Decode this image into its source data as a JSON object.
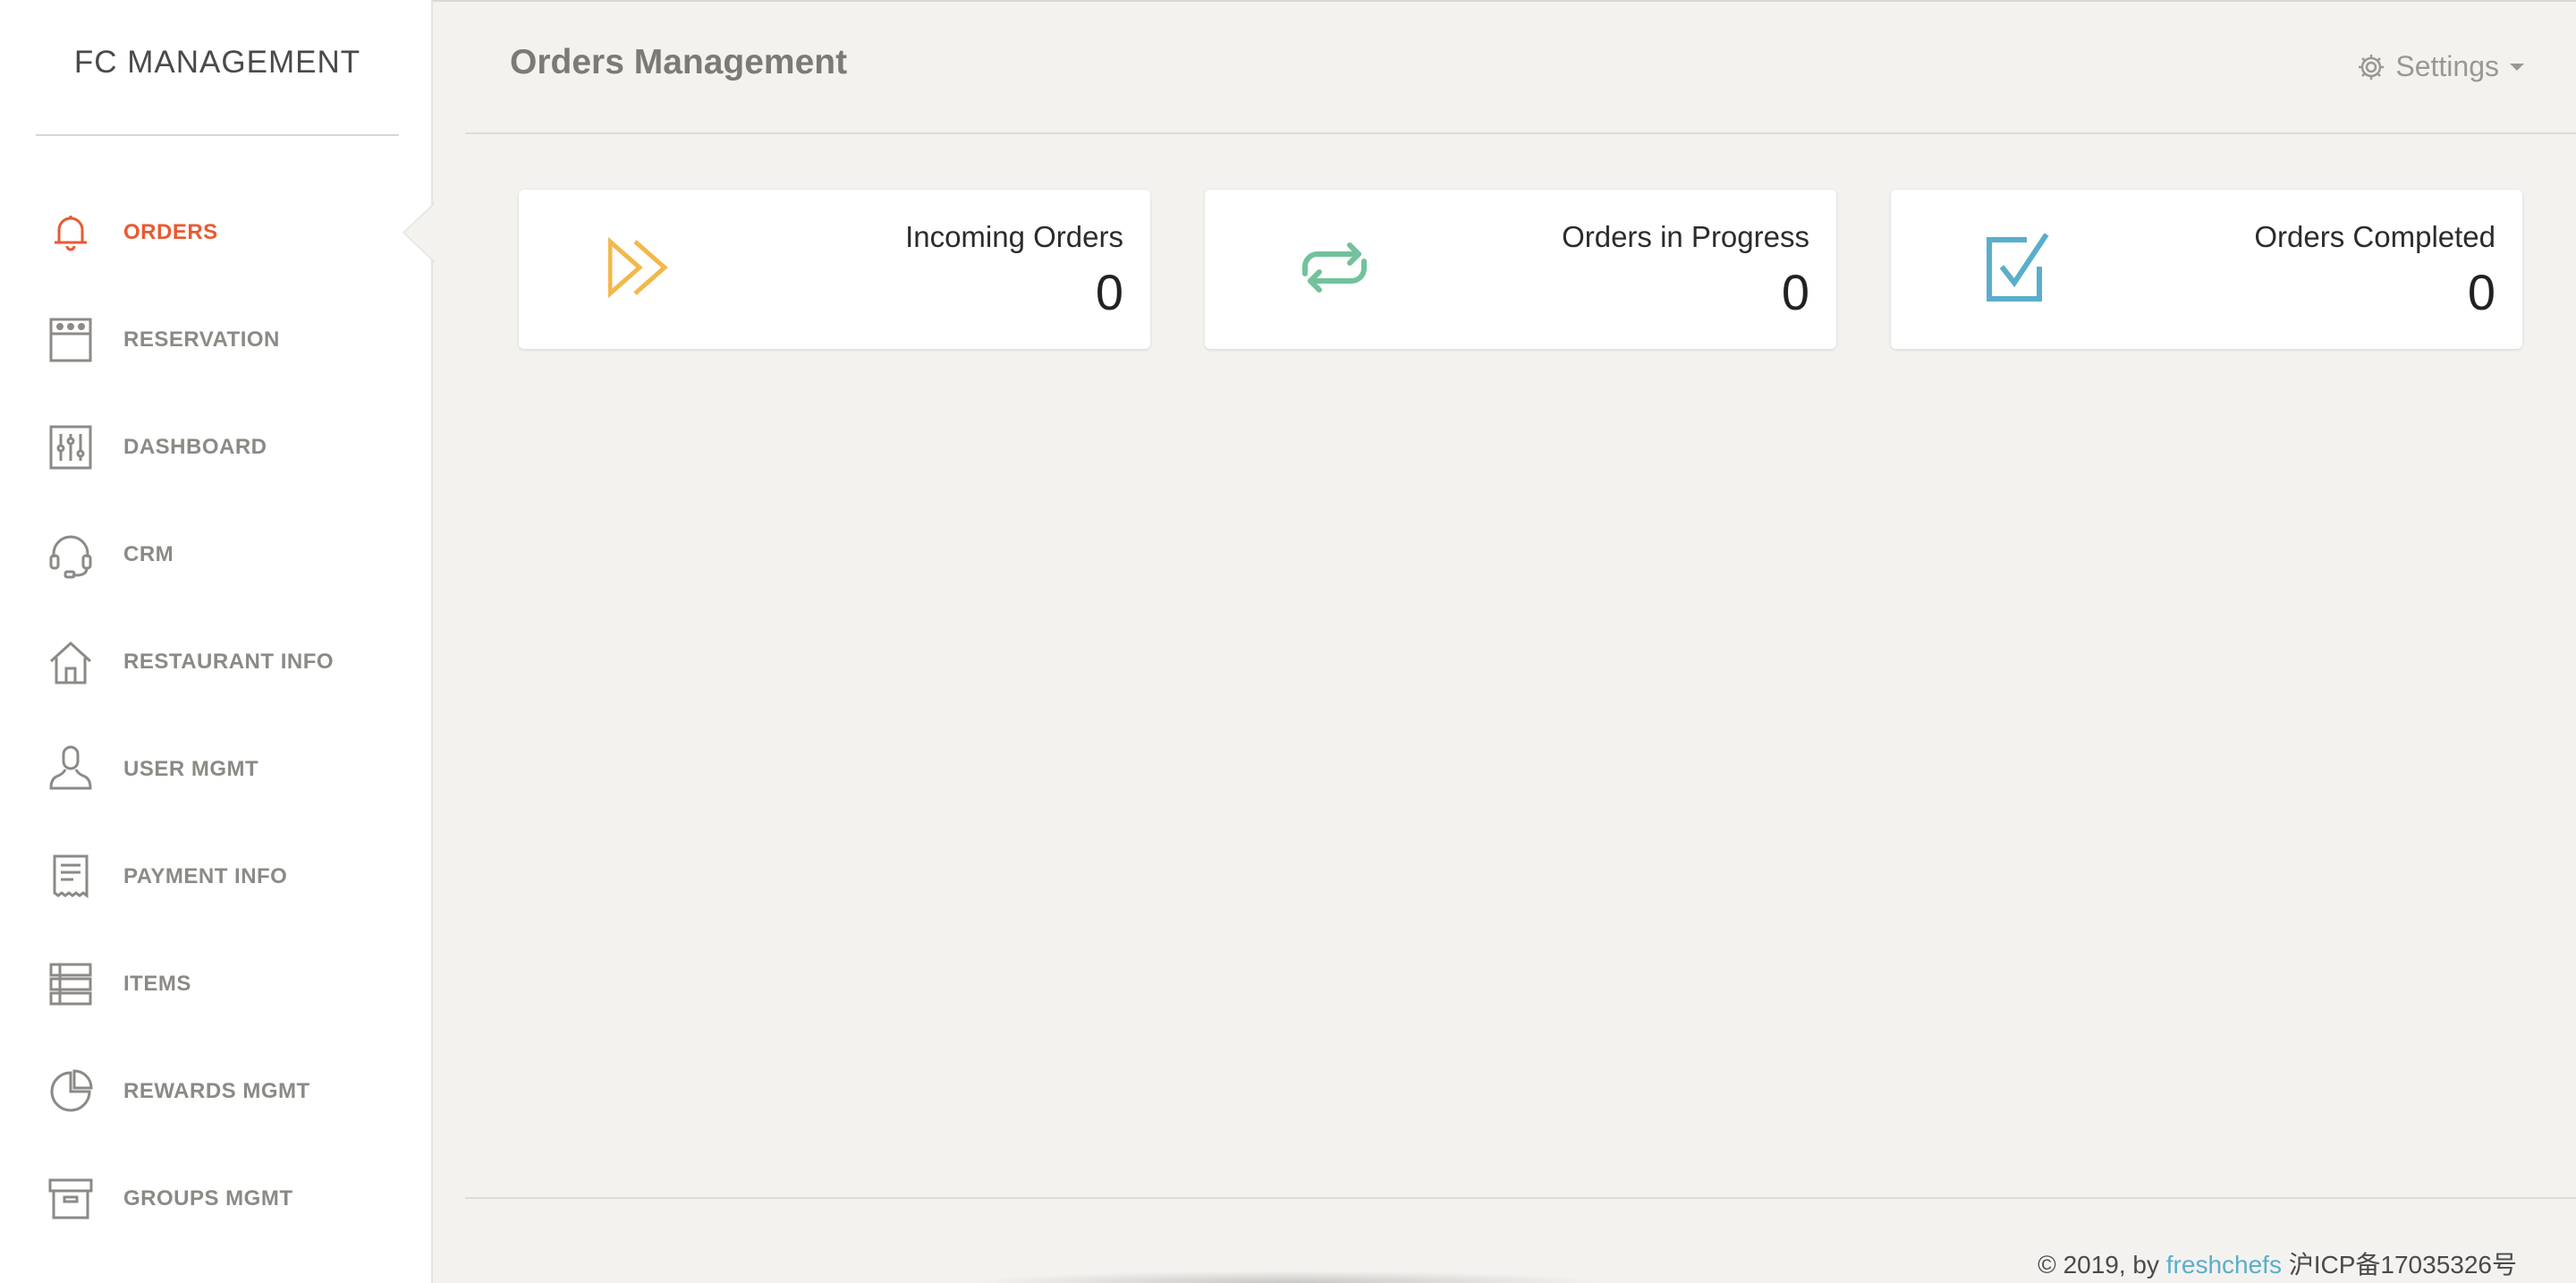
{
  "brand": "FC MANAGEMENT",
  "nav": {
    "items": [
      {
        "label": "ORDERS",
        "icon": "bell-icon",
        "active": true
      },
      {
        "label": "RESERVATION",
        "icon": "calendar-icon",
        "active": false
      },
      {
        "label": "DASHBOARD",
        "icon": "sliders-icon",
        "active": false
      },
      {
        "label": "CRM",
        "icon": "headset-icon",
        "active": false
      },
      {
        "label": "RESTAURANT INFO",
        "icon": "home-icon",
        "active": false
      },
      {
        "label": "USER MGMT",
        "icon": "user-icon",
        "active": false
      },
      {
        "label": "PAYMENT INFO",
        "icon": "receipt-icon",
        "active": false
      },
      {
        "label": "ITEMS",
        "icon": "list-icon",
        "active": false
      },
      {
        "label": "REWARDS MGMT",
        "icon": "pie-chart-icon",
        "active": false
      },
      {
        "label": "GROUPS MGMT",
        "icon": "archive-icon",
        "active": false
      }
    ]
  },
  "header": {
    "title": "Orders Management",
    "settings_label": "Settings"
  },
  "cards": [
    {
      "title": "Incoming Orders",
      "value": "0",
      "icon": "double-chevron-right-icon",
      "color": "#f2b84b"
    },
    {
      "title": "Orders in Progress",
      "value": "0",
      "icon": "repeat-icon",
      "color": "#72c29b"
    },
    {
      "title": "Orders Completed",
      "value": "0",
      "icon": "checkbox-icon",
      "color": "#5aaecb"
    }
  ],
  "colors": {
    "accent": "#e95a31",
    "nav_text": "#8c8a85",
    "background": "#f3f2ef"
  },
  "footer": {
    "copyright": "© 2019, by ",
    "link_text": "freshchefs",
    "icp": " 沪ICP备17035326号"
  }
}
